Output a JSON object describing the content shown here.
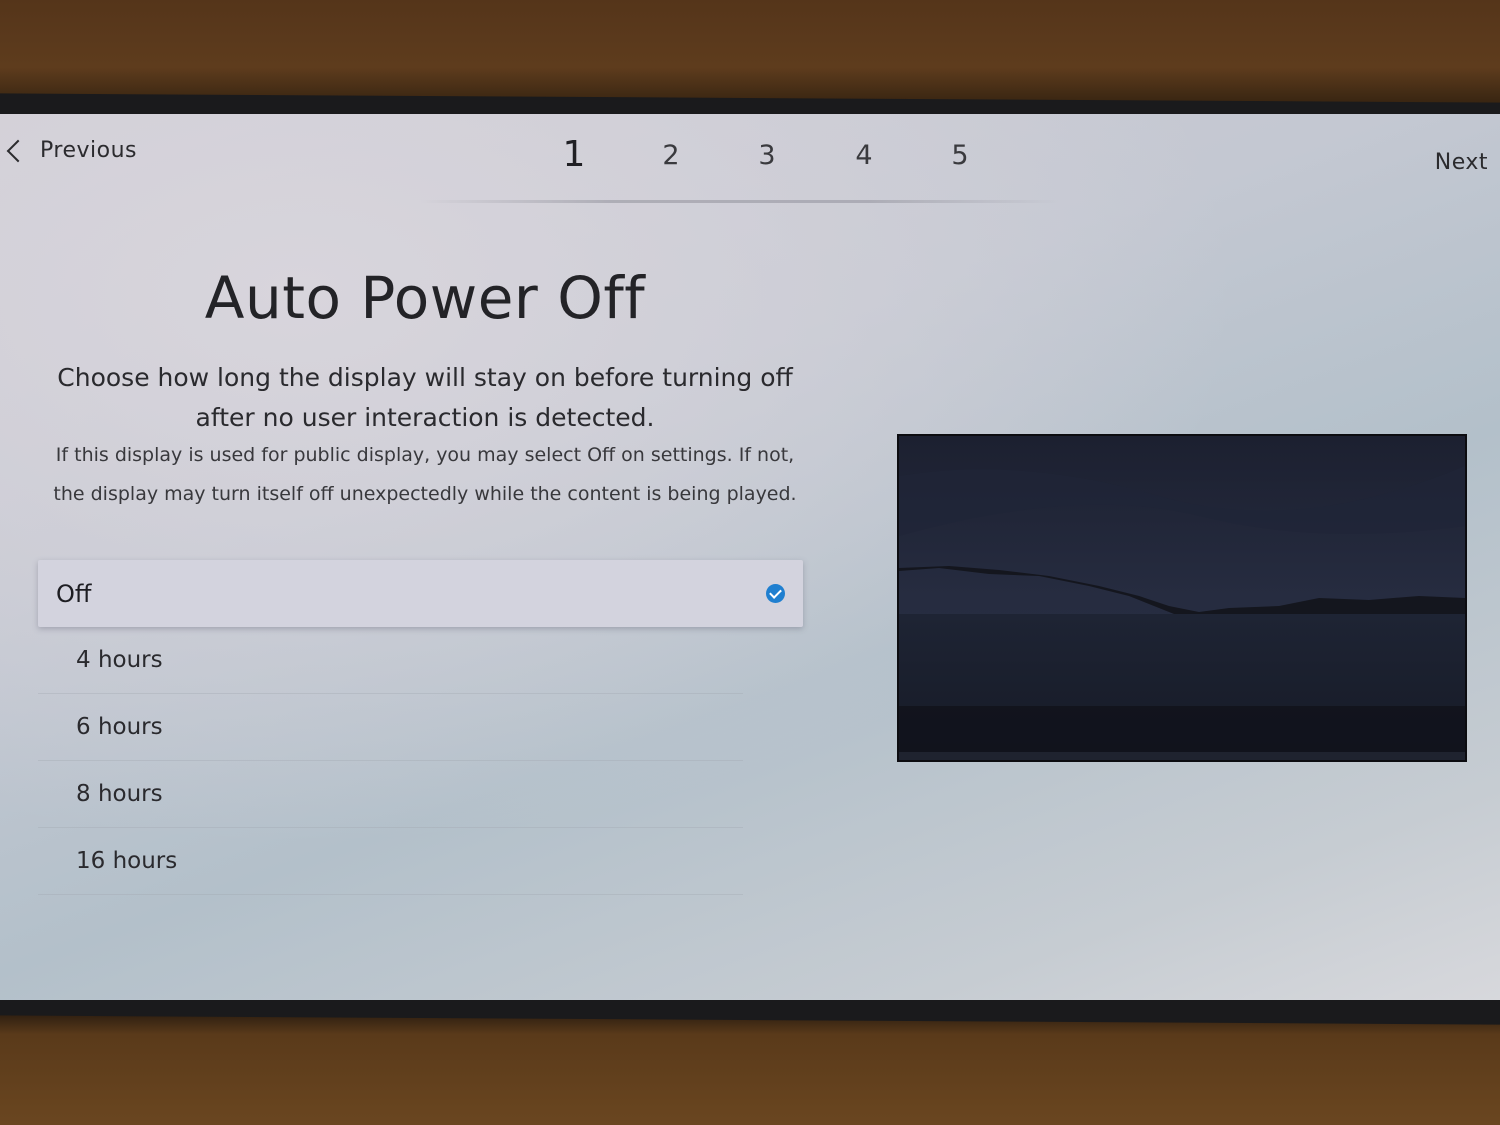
{
  "nav": {
    "previous_label": "Previous",
    "next_label": "Next",
    "steps": [
      "1",
      "2",
      "3",
      "4",
      "5"
    ],
    "active_step": "1"
  },
  "content": {
    "title": "Auto Power Off",
    "description": "Choose how long the display will stay on before turning off after no user interaction is detected.",
    "note": "If this display is used for public display, you may select Off on settings. If not, the display may turn itself off unexpectedly while the content is being played."
  },
  "options": [
    {
      "label": "Off",
      "selected": true
    },
    {
      "label": "4 hours",
      "selected": false
    },
    {
      "label": "6 hours",
      "selected": false
    },
    {
      "label": "8 hours",
      "selected": false
    },
    {
      "label": "16 hours",
      "selected": false
    }
  ],
  "colors": {
    "accent": "#1f7fd0",
    "selected_row": "#d3d3de",
    "text": "#2a2a2e"
  },
  "icons": {
    "previous": "chevron-left-icon",
    "selected": "check-circle-icon"
  }
}
